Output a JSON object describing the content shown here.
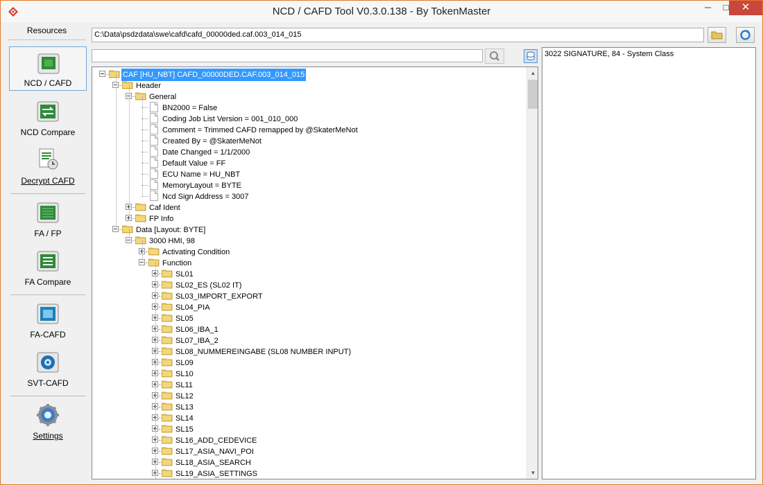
{
  "window": {
    "title": "NCD / CAFD Tool V0.3.0.138 - By TokenMaster",
    "minimize": "─",
    "maximize": "□",
    "close": "✕"
  },
  "sidebar": {
    "header": "Resources",
    "items": [
      {
        "label": "NCD / CAFD",
        "icon": "chip-icon"
      },
      {
        "label": "NCD Compare",
        "icon": "compare-arrows-icon"
      },
      {
        "label": "Decrypt CAFD",
        "icon": "decrypt-doc-icon"
      },
      {
        "label": "FA / FP",
        "icon": "fa-fp-icon"
      },
      {
        "label": "FA Compare",
        "icon": "fa-compare-icon"
      },
      {
        "label": "FA-CAFD",
        "icon": "fa-cafd-icon"
      },
      {
        "label": "SVT-CAFD",
        "icon": "svt-cafd-icon"
      },
      {
        "label": "Settings",
        "icon": "gear-icon"
      }
    ]
  },
  "path_bar": {
    "value": "C:\\Data\\psdzdata\\swe\\cafd\\cafd_00000ded.caf.003_014_015"
  },
  "search": {
    "value": ""
  },
  "tree": {
    "root": "CAF [HU_NBT]  CAFD_00000DED.CAF.003_014_015",
    "header": "Header",
    "general": "General",
    "general_items": [
      "BN2000 = False",
      "Coding Job List Version = 001_010_000",
      "Comment = Trimmed CAFD remapped by @SkaterMeNot",
      "Created By = @SkaterMeNot",
      "Date Changed = 1/1/2000",
      "Default Value = FF",
      "ECU Name = HU_NBT",
      "MemoryLayout = BYTE",
      "Ncd Sign Address = 3007"
    ],
    "caf_ident": "Caf Ident",
    "fp_info": "FP Info",
    "data": "Data [Layout: BYTE]",
    "hmi": "3000 HMI, 98",
    "activating_condition": "Activating Condition",
    "function": "Function",
    "functions": [
      "SL01",
      "SL02_ES (SL02 IT)",
      "SL03_IMPORT_EXPORT",
      "SL04_PIA",
      "SL05",
      "SL06_IBA_1",
      "SL07_IBA_2",
      "SL08_NUMMEREINGABE (SL08 NUMBER INPUT)",
      "SL09",
      "SL10",
      "SL11",
      "SL12",
      "SL13",
      "SL14",
      "SL15",
      "SL16_ADD_CEDEVICE",
      "SL17_ASIA_NAVI_POI",
      "SL18_ASIA_SEARCH",
      "SL19_ASIA_SETTINGS"
    ]
  },
  "detail": {
    "text": "3022 SIGNATURE, 84  - System Class"
  },
  "colors": {
    "selection": "#3399ff",
    "close_button": "#c9473c",
    "folder": "#e8c35a",
    "window_border": "#e27a2a"
  }
}
